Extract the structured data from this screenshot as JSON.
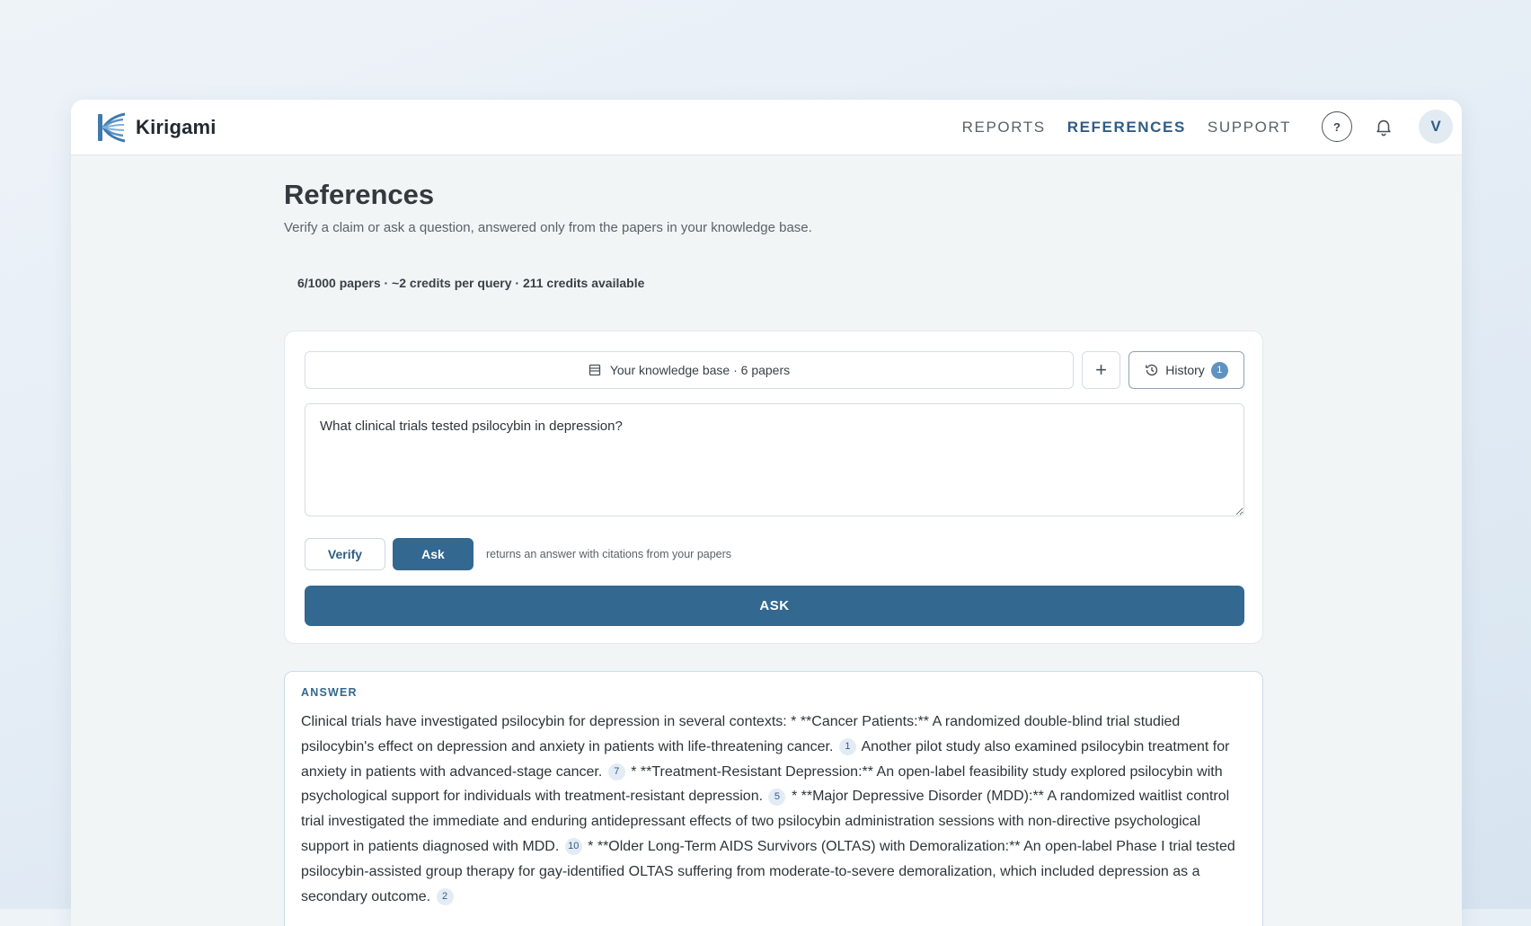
{
  "app": {
    "brand": "Kirigami"
  },
  "nav": {
    "items": [
      {
        "label": "REPORTS",
        "active": false
      },
      {
        "label": "REFERENCES",
        "active": true
      },
      {
        "label": "SUPPORT",
        "active": false
      }
    ]
  },
  "header": {
    "help_icon": "question-mark-icon",
    "bell_icon": "bell-icon",
    "avatar_initial": "V"
  },
  "page": {
    "title": "References",
    "subtitle": "Verify a claim or ask a question, answered only from the papers in your knowledge base.",
    "stats": "6/1000 papers · ~2 credits per query · 211 credits available"
  },
  "query_card": {
    "knowledge_base_label": "Your knowledge base · 6 papers",
    "add_label": "+",
    "history_label": "History",
    "history_count": "1",
    "question_value": "What clinical trials tested psilocybin in depression?",
    "mode_verify": "Verify",
    "mode_ask": "Ask",
    "mode_hint": "returns an answer with citations from your papers",
    "submit_label": "ASK"
  },
  "answer": {
    "label": "ANSWER",
    "segments": [
      {
        "text": "Clinical trials have investigated psilocybin for depression in several contexts: * **Cancer Patients:** A randomized double-blind trial studied psilocybin's effect on depression and anxiety in patients with life-threatening cancer.",
        "cite": "1"
      },
      {
        "text": "Another pilot study also examined psilocybin treatment for anxiety in patients with advanced-stage cancer.",
        "cite": "7"
      },
      {
        "text": "* **Treatment-Resistant Depression:** An open-label feasibility study explored psilocybin with psychological support for individuals with treatment-resistant depression.",
        "cite": "5"
      },
      {
        "text": "* **Major Depressive Disorder (MDD):** A randomized waitlist control trial investigated the immediate and enduring antidepressant effects of two psilocybin administration sessions with non-directive psychological support in patients diagnosed with MDD.",
        "cite": "10"
      },
      {
        "text": "* **Older Long-Term AIDS Survivors (OLTAS) with Demoralization:** An open-label Phase I trial tested psilocybin-assisted group therapy for gay-identified OLTAS suffering from moderate-to-severe demoralization, which included depression as a secondary outcome.",
        "cite": "2"
      }
    ]
  },
  "colors": {
    "accent": "#336891",
    "active_nav": "#2f5d86",
    "badge": "#5f92c0"
  }
}
